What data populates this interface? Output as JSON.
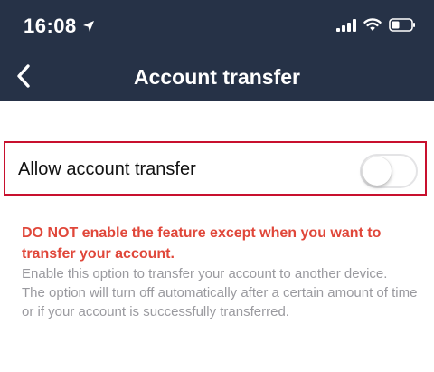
{
  "status_bar": {
    "time": "16:08",
    "icons": [
      "location-arrow-icon",
      "signal-icon",
      "wifi-icon",
      "battery-icon"
    ]
  },
  "nav": {
    "back_icon": "chevron-left-icon",
    "title": "Account transfer"
  },
  "setting": {
    "label": "Allow account transfer",
    "toggle_on": false
  },
  "description": {
    "warning": "DO NOT enable the feature except when you want to transfer your account.",
    "line1": "Enable this option to transfer your account to another device.",
    "line2": "The option will turn off automatically after a certain amount of time or if your account is successfully transferred."
  },
  "colors": {
    "header_bg": "#263247",
    "highlight_border": "#c8102e",
    "warning_text": "#e0473a",
    "info_text": "#9a9a9f"
  }
}
